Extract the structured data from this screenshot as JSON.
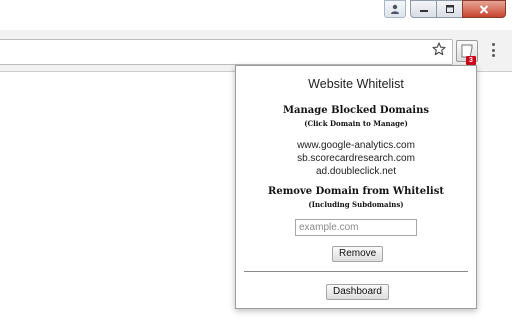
{
  "window": {
    "icons": [
      "user-icon",
      "minimize-icon",
      "maximize-icon",
      "close-icon"
    ]
  },
  "toolbar": {
    "icons": [
      "star-icon",
      "extension-icon",
      "menu-icon"
    ],
    "extension_badge": "3",
    "badge_color": "#d0021b"
  },
  "popup": {
    "title": "Website Whitelist",
    "manage_heading": "Manage Blocked Domains",
    "manage_subheading": "(Click Domain to Manage)",
    "domains": [
      "www.google-analytics.com",
      "sb.scorecardresearch.com",
      "ad.doubleclick.net"
    ],
    "remove_heading": "Remove Domain from Whitelist",
    "remove_subheading": "(Including Subdomains)",
    "input_placeholder": "example.com",
    "input_value": "",
    "remove_button": "Remove",
    "dashboard_button": "Dashboard"
  }
}
